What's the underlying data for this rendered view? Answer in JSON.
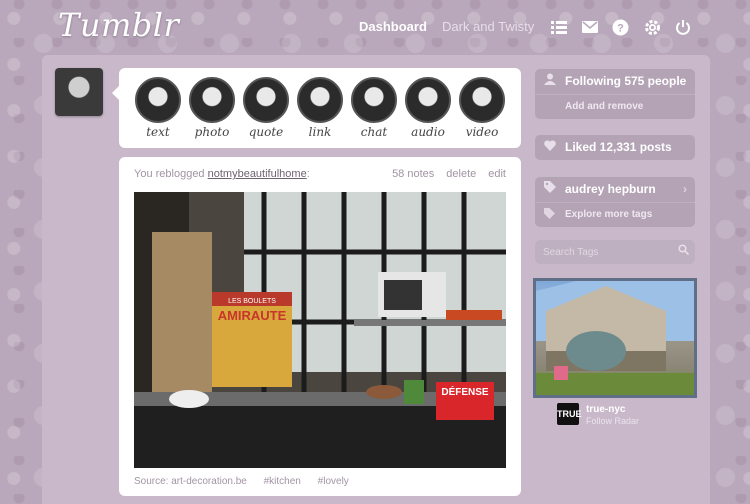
{
  "header": {
    "logo": "Tumblr",
    "nav_dashboard": "Dashboard",
    "nav_blog": "Dark and Twisty",
    "icons": [
      "list-icon",
      "mail-icon",
      "help-icon",
      "gear-icon",
      "power-icon"
    ]
  },
  "post_types": [
    {
      "label": "text"
    },
    {
      "label": "photo"
    },
    {
      "label": "quote"
    },
    {
      "label": "link"
    },
    {
      "label": "chat"
    },
    {
      "label": "audio"
    },
    {
      "label": "video"
    }
  ],
  "post": {
    "reblog_prefix": "You reblogged",
    "reblog_user": "notmybeautifulhome",
    "notes": "58 notes",
    "delete": "delete",
    "edit": "edit",
    "source": "Source: art-decoration.be",
    "tags": [
      "#kitchen",
      "#lovely"
    ],
    "image_signs": {
      "poster_top": "LES BOULETS",
      "poster_main": "AMIRAUTE",
      "sign_main": "DÉFENSE"
    }
  },
  "sidebar": {
    "following": "Following 575 people",
    "following_sub": "Add and remove",
    "liked": "Liked 12,331 posts",
    "tag": "audrey hepburn",
    "tag_sub": "Explore more tags",
    "search_placeholder": "Search Tags",
    "radar_name": "true-nyc",
    "radar_sub": "Follow Radar",
    "radar_thumb_text": "TRUE"
  }
}
